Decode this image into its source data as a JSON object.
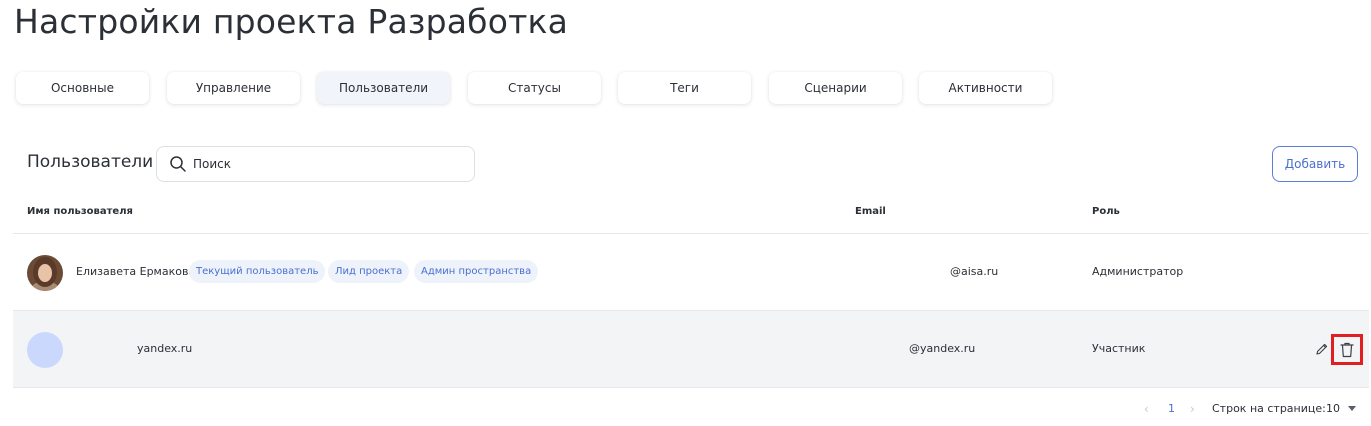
{
  "page": {
    "title": "Настройки проекта Разработка"
  },
  "tabs": [
    {
      "label": "Основные",
      "active": false
    },
    {
      "label": "Управление",
      "active": false
    },
    {
      "label": "Пользователи",
      "active": true
    },
    {
      "label": "Статусы",
      "active": false
    },
    {
      "label": "Теги",
      "active": false
    },
    {
      "label": "Сценарии",
      "active": false
    },
    {
      "label": "Активности",
      "active": false
    }
  ],
  "users_section": {
    "title": "Пользователи",
    "search": {
      "placeholder": "Поиск",
      "value": ""
    },
    "add_label": "Добавить"
  },
  "table": {
    "columns": [
      "Имя пользователя",
      "Email",
      "Роль"
    ],
    "rows": [
      {
        "name": "Елизавета Ермакова",
        "badges": [
          "Текущий пользователь",
          "Лид проекта",
          "Админ пространства"
        ],
        "email": "@aisa.ru",
        "role": "Администратор"
      },
      {
        "name": "yandex.ru",
        "badges": [],
        "email": "@yandex.ru",
        "role": "Участник"
      }
    ]
  },
  "pagination": {
    "current_page": "1",
    "rows_label": "Строк на странице:",
    "rows_value": "10"
  },
  "colors": {
    "accent": "#4a6fcf",
    "delete_highlight": "#e02020",
    "selected_row": "#f3f4f6",
    "avatar_placeholder": "#c9d8fc"
  },
  "icons": [
    "search-icon",
    "edit-icon",
    "delete-icon",
    "chevron-left-icon",
    "chevron-right-icon",
    "caret-down-icon"
  ]
}
